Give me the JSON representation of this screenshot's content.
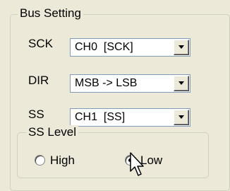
{
  "bus_setting": {
    "title": "Bus Setting",
    "rows": [
      {
        "label": "SCK",
        "value": "CH0  [SCK]"
      },
      {
        "label": "DIR",
        "value": "MSB -> LSB"
      },
      {
        "label": "SS",
        "value": "CH1  [SS]"
      }
    ],
    "ss_level": {
      "title": "SS Level",
      "options": [
        {
          "label": "High",
          "selected": false
        },
        {
          "label": "Low",
          "selected": true
        }
      ]
    }
  },
  "icons": {
    "dropdown": "chevron-down-icon",
    "cursor": "mouse-pointer-icon"
  }
}
